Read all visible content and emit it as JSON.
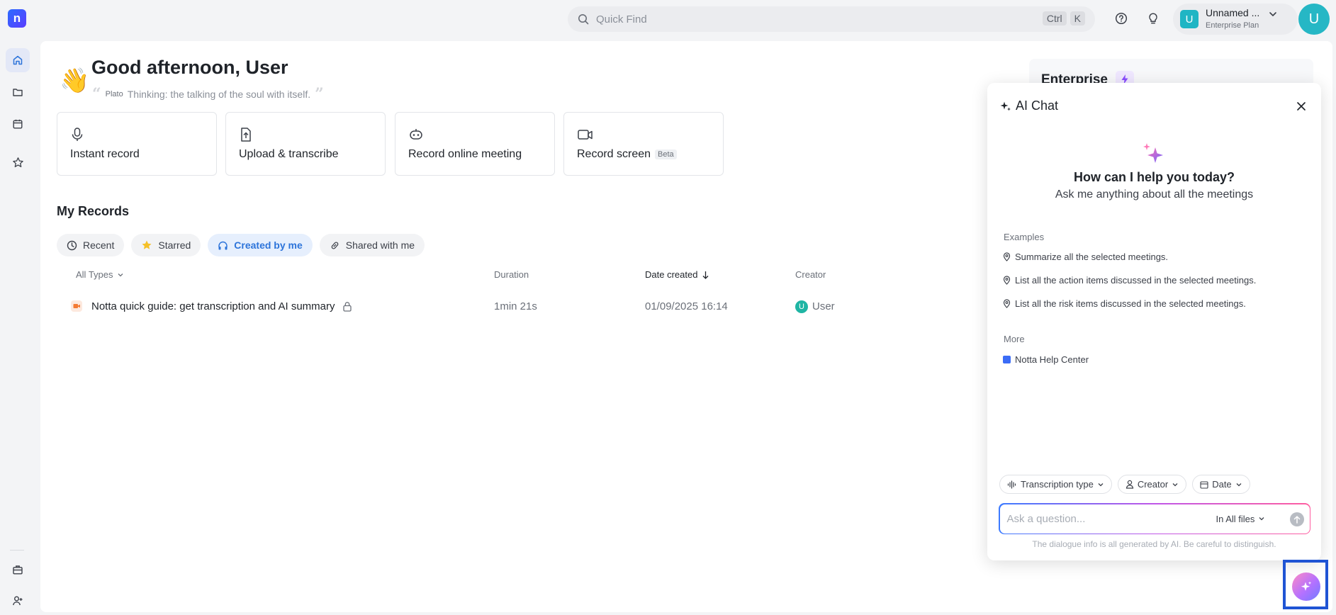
{
  "app": {
    "logo_letter": "n"
  },
  "search": {
    "placeholder": "Quick Find",
    "keys": [
      "Ctrl",
      "K"
    ]
  },
  "workspace": {
    "avatar_letter": "U",
    "name": "Unnamed ...",
    "plan": "Enterprise Plan"
  },
  "user": {
    "avatar_letter": "U"
  },
  "sidebar": {
    "items": [
      {
        "name": "home",
        "icon": "home-icon",
        "active": true
      },
      {
        "name": "folder",
        "icon": "folder-icon",
        "active": false
      },
      {
        "name": "calendar",
        "icon": "calendar-icon",
        "active": false
      },
      {
        "name": "starred",
        "icon": "star-icon",
        "active": false
      },
      {
        "name": "briefcase",
        "icon": "briefcase-icon",
        "active": false
      },
      {
        "name": "add-user",
        "icon": "add-user-icon",
        "active": false
      }
    ]
  },
  "greeting": {
    "emoji": "👋",
    "text": "Good afternoon, User",
    "quote_author": "Plato",
    "quote_text": "Thinking: the talking of the soul with itself."
  },
  "actions": [
    {
      "label": "Instant record",
      "icon": "microphone-icon"
    },
    {
      "label": "Upload & transcribe",
      "icon": "upload-file-icon"
    },
    {
      "label": "Record online meeting",
      "icon": "meeting-bot-icon"
    },
    {
      "label": "Record screen",
      "badge": "Beta",
      "icon": "video-camera-icon"
    }
  ],
  "records": {
    "title": "My Records",
    "tabs": [
      {
        "label": "Recent",
        "icon": "clock-icon",
        "selected": false
      },
      {
        "label": "Starred",
        "icon": "star-icon",
        "selected": false
      },
      {
        "label": "Created by me",
        "icon": "headphones-icon",
        "selected": true
      },
      {
        "label": "Shared with me",
        "icon": "link-icon",
        "selected": false
      }
    ],
    "columns": {
      "type": "All Types",
      "duration": "Duration",
      "date": "Date created",
      "creator": "Creator"
    },
    "rows": [
      {
        "title": "Notta quick guide: get transcription and AI summary",
        "duration": "1min 21s",
        "date": "01/09/2025 16:14",
        "creator": "User",
        "creator_initial": "U"
      }
    ]
  },
  "enterprise_card": {
    "title": "Enterprise"
  },
  "ai_chat": {
    "title": "AI Chat",
    "heading": "How can I help you today?",
    "subheading": "Ask me anything about all the meetings",
    "examples_label": "Examples",
    "examples": [
      "Summarize all the selected meetings.",
      "List all the action items discussed in the selected meetings.",
      "List all the risk items discussed in the selected meetings."
    ],
    "more_label": "More",
    "more_link": "Notta Help Center",
    "filters": [
      "Transcription type",
      "Creator",
      "Date"
    ],
    "input_placeholder": "Ask a question...",
    "scope": "In All files",
    "disclaimer": "The dialogue info is all generated by AI. Be careful to distinguish."
  },
  "colors": {
    "accent": "#2d74da",
    "teal": "#1fb5c4",
    "highlight_frame": "#1f54d4"
  }
}
